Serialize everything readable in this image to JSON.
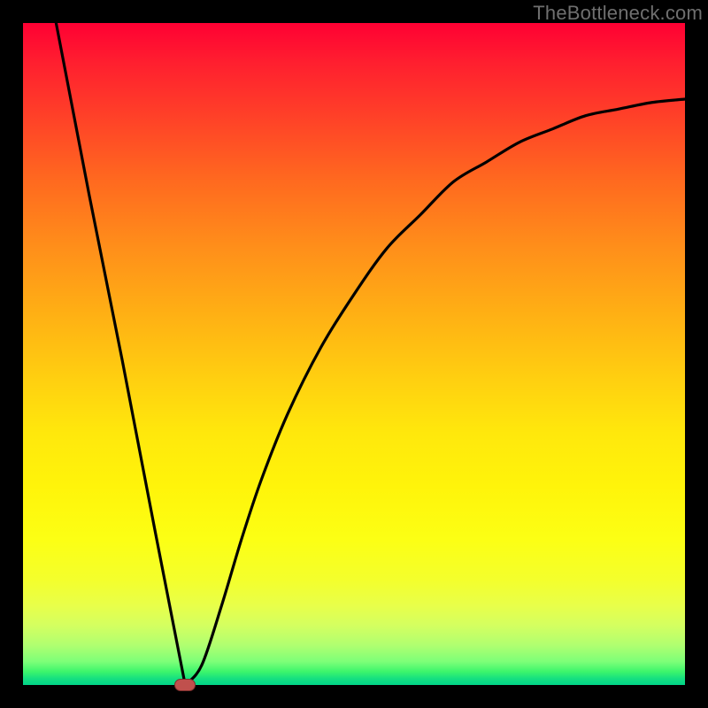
{
  "watermark": "TheBottleneck.com",
  "chart_data": {
    "type": "line",
    "title": "",
    "xlabel": "",
    "ylabel": "",
    "xlim": [
      0,
      1
    ],
    "ylim": [
      0,
      1
    ],
    "series": [
      {
        "name": "bottleneck-curve",
        "x": [
          0.05,
          0.1,
          0.15,
          0.2,
          0.245,
          0.27,
          0.3,
          0.33,
          0.36,
          0.4,
          0.45,
          0.5,
          0.55,
          0.6,
          0.65,
          0.7,
          0.75,
          0.8,
          0.85,
          0.9,
          0.95,
          1.0
        ],
        "y": [
          1.0,
          0.74,
          0.49,
          0.23,
          0.0,
          0.03,
          0.12,
          0.22,
          0.31,
          0.41,
          0.51,
          0.59,
          0.66,
          0.71,
          0.76,
          0.79,
          0.82,
          0.84,
          0.86,
          0.87,
          0.88,
          0.885
        ]
      }
    ],
    "annotations": [
      {
        "name": "minimum-marker",
        "x": 0.245,
        "y": 0.0
      }
    ],
    "background_gradient": {
      "top": "#ff0033",
      "middle": "#ffe80c",
      "bottom": "#00d488"
    }
  }
}
